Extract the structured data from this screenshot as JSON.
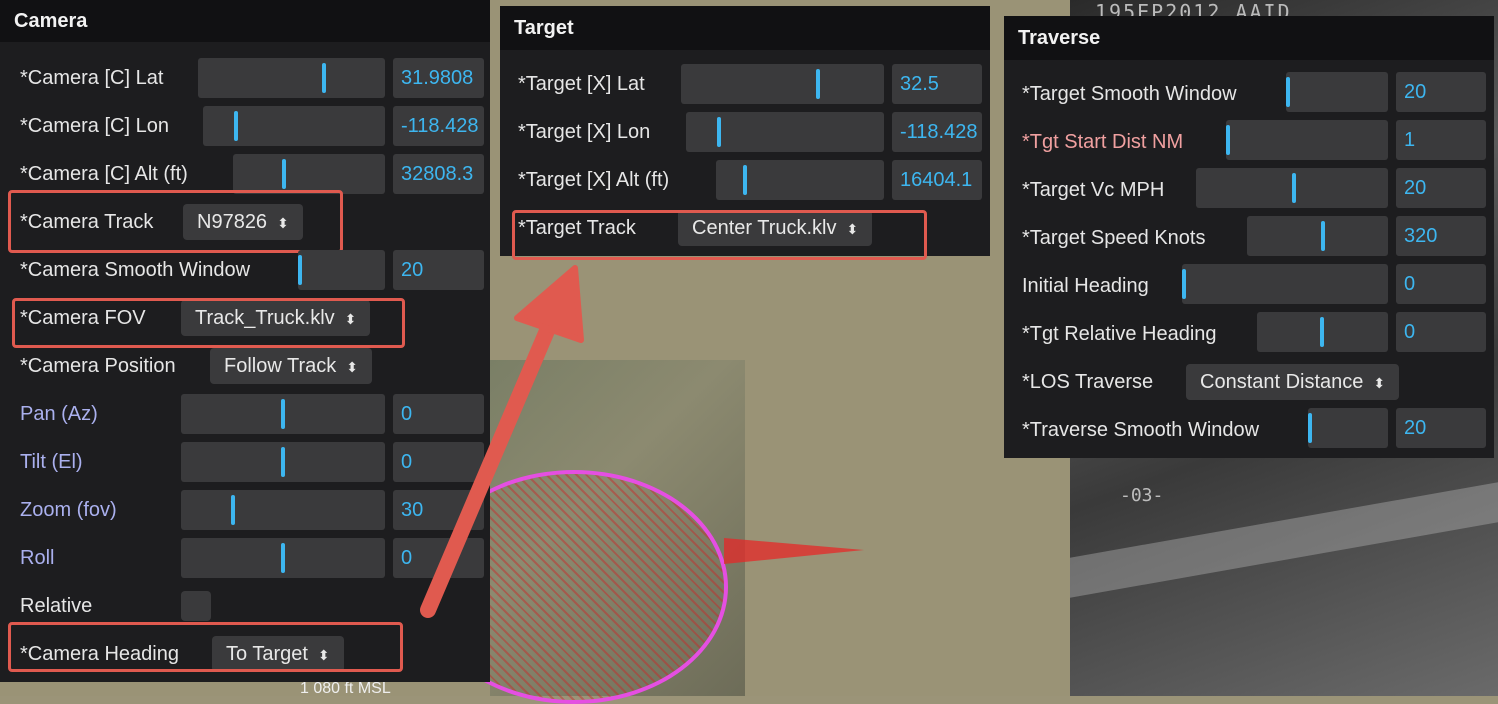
{
  "background": {
    "video_overlay_text": "195EP2012   AAID",
    "video_runway_marker": "-03-",
    "map_label": "1 080 ft MSL"
  },
  "camera": {
    "title": "Camera",
    "lat_label": "*Camera [C] Lat",
    "lat_value": "31.9808",
    "lon_label": "*Camera [C] Lon",
    "lon_value": "-118.428",
    "alt_label": "*Camera [C] Alt (ft)",
    "alt_value": "32808.3",
    "track_label": "*Camera Track",
    "track_value": "N97826",
    "smooth_label": "*Camera Smooth Window",
    "smooth_value": "20",
    "fov_label": "*Camera FOV",
    "fov_value": "Track_Truck.klv",
    "position_label": "*Camera Position",
    "position_value": "Follow Track",
    "pan_label": "Pan (Az)",
    "pan_value": "0",
    "tilt_label": "Tilt (El)",
    "tilt_value": "0",
    "zoom_label": "Zoom (fov)",
    "zoom_value": "30",
    "roll_label": "Roll",
    "roll_value": "0",
    "relative_label": "Relative",
    "heading_label": "*Camera Heading",
    "heading_value": "To Target"
  },
  "target": {
    "title": "Target",
    "lat_label": "*Target [X] Lat",
    "lat_value": "32.5",
    "lon_label": "*Target [X] Lon",
    "lon_value": "-118.428",
    "alt_label": "*Target [X] Alt (ft)",
    "alt_value": "16404.1",
    "track_label": "*Target Track",
    "track_value": "Center Truck.klv"
  },
  "traverse": {
    "title": "Traverse",
    "smooth_label": "*Target Smooth Window",
    "smooth_value": "20",
    "start_dist_label": "*Tgt Start Dist NM",
    "start_dist_value": "1",
    "vc_label": "*Target Vc MPH",
    "vc_value": "20",
    "speed_label": "*Target Speed Knots",
    "speed_value": "320",
    "initial_heading_label": "Initial Heading",
    "initial_heading_value": "0",
    "rel_heading_label": "*Tgt Relative Heading",
    "rel_heading_value": "0",
    "los_label": "*LOS Traverse",
    "los_value": "Constant Distance",
    "trav_smooth_label": "*Traverse Smooth Window",
    "trav_smooth_value": "20"
  },
  "colors": {
    "accent": "#3db6f0",
    "highlight": "#e05a4f",
    "panel": "#1d1d1f"
  }
}
